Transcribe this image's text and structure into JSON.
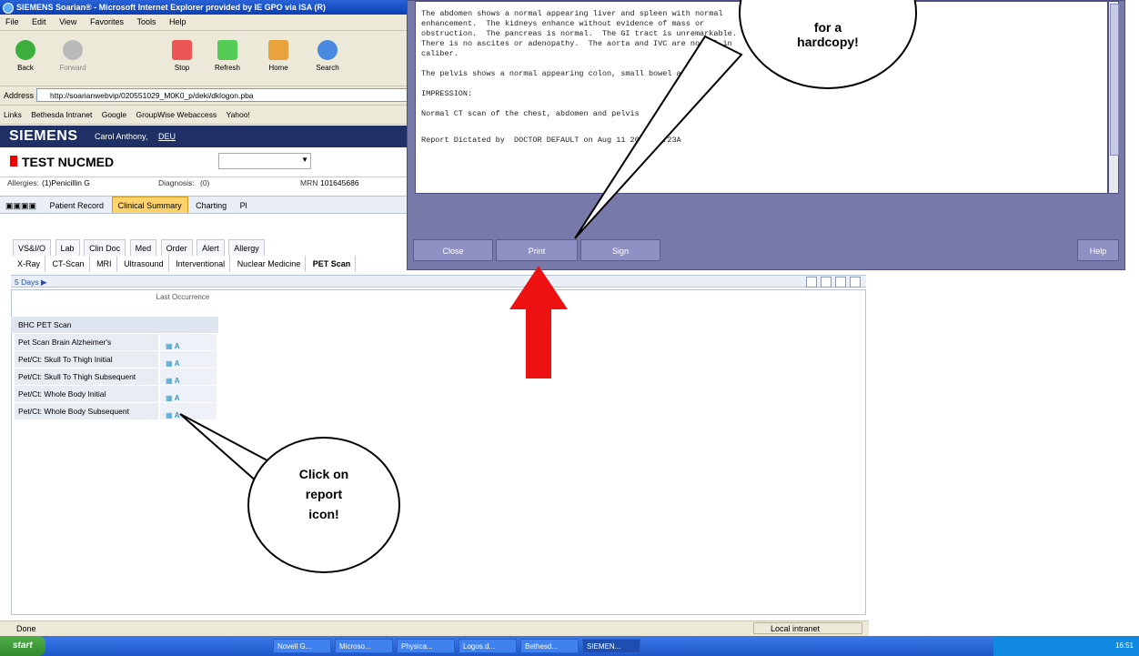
{
  "window": {
    "title": "SIEMENS Soarian® - Microsoft Internet Explorer provided by IE GPO via ISA (R)",
    "menu": [
      "File",
      "Edit",
      "View",
      "Favorites",
      "Tools",
      "Help"
    ],
    "toolbar": [
      "Back",
      "Forward",
      "Stop",
      "Refresh",
      "Home",
      "Search"
    ],
    "address_label": "Address",
    "address_url": "http://soarianwebvip/020551029_M0K0_p/deki/dklogon.pba",
    "links_label": "Links",
    "links": [
      "Bethesda Intranet",
      "Google",
      "GroupWise Webaccess",
      "Yahoo!"
    ],
    "status": "Done",
    "zone": "Local intranet"
  },
  "app": {
    "brand": "SIEMENS",
    "user": "Carol Anthony,",
    "dept": "DEU",
    "patient_name": "TEST NUCMED",
    "allergies_label": "Allergies:",
    "allergies": "(1)Penicillin G",
    "diagnosis_label": "Diagnosis:",
    "diagnosis": "(0)",
    "mrn_label": "MRN",
    "mrn": "101645686",
    "nav_tabs": [
      "Patient Record",
      "Clinical Summary",
      "Charting",
      "Pl"
    ],
    "categories": [
      "VS&I/O",
      "Lab",
      "Clin Doc",
      "Med",
      "Order",
      "Alert",
      "Allergy"
    ],
    "types": [
      "X-Ray",
      "CT-Scan",
      "MRI",
      "Ultrasound",
      "Interventional",
      "Nuclear Medicine",
      "PET Scan"
    ],
    "active_type": "PET Scan",
    "days_filter": "5 Days",
    "col_header": "Last Occurrence",
    "group_header": "BHC PET Scan",
    "rows": [
      "Pet Scan Brain Alzheimer's",
      "Pet/Ct: Skull To Thigh Initial",
      "Pet/Ct: Skull To Thigh Subsequent",
      "Pet/Ct: Whole Body Initial",
      "Pet/Ct: Whole Body Subsequent"
    ],
    "report_marker": "A"
  },
  "report": {
    "paragraphs": [
      "The abdomen shows a normal appearing liver and spleen with normal\nenhancement.  The kidneys enhance without evidence of mass or\nobstruction.  The pancreas is normal.  The GI tract is unremarkable.\nThere is no ascites or adenopathy.  The aorta and IVC are normal in\ncaliber.",
      "The pelvis shows a normal appearing colon, small bowel and b",
      "IMPRESSION:",
      "Normal CT scan of the chest, abdomen and pelvis"
    ],
    "dictated": "Report Dictated by  DOCTOR DEFAULT on Aug 11 2010 10:23A",
    "buttons": {
      "close": "Close",
      "print": "Print",
      "sign": "Sign",
      "help": "Help"
    }
  },
  "callouts": {
    "print_line1": "for a",
    "print_line2": "hardcopy!",
    "icon_line1": "Click on",
    "icon_line2": "report",
    "icon_line3": "icon!"
  },
  "taskbar": {
    "start": "start",
    "tasks": [
      "Novell G...",
      "Microso...",
      "Physica...",
      "Logos.d...",
      "Bethesd...",
      "SIEMEN..."
    ],
    "clock": "16:51"
  },
  "colors": {
    "arrow": "#ee1111",
    "siemens_banner": "#1e3064",
    "report_bg": "#7779a9"
  }
}
